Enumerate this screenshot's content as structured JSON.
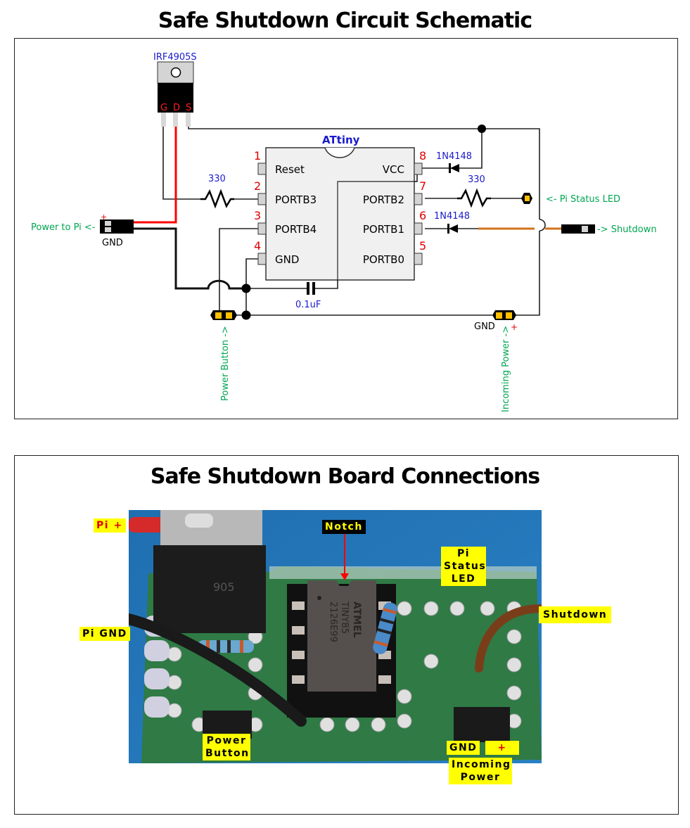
{
  "schematic": {
    "title": "Safe Shutdown Circuit Schematic",
    "mosfet": {
      "part": "IRF4905S",
      "pins": [
        "G",
        "D",
        "S"
      ]
    },
    "chip": {
      "name": "ATtiny",
      "left_pins": [
        {
          "num": "1",
          "label": "Reset"
        },
        {
          "num": "2",
          "label": "PORTB3"
        },
        {
          "num": "3",
          "label": "PORTB4"
        },
        {
          "num": "4",
          "label": "GND"
        }
      ],
      "right_pins": [
        {
          "num": "8",
          "label": "VCC"
        },
        {
          "num": "7",
          "label": "PORTB2"
        },
        {
          "num": "6",
          "label": "PORTB1"
        },
        {
          "num": "5",
          "label": "PORTB0"
        }
      ]
    },
    "components": {
      "resistor_gate": "330",
      "resistor_led": "330",
      "diode_vcc": "1N4148",
      "diode_shutdown": "1N4148",
      "capacitor": "0.1uF"
    },
    "connectors": {
      "power_to_pi": "Power to Pi <-",
      "power_to_pi_plus": "+",
      "power_to_pi_gnd": "GND",
      "pi_status_led": "<- Pi Status LED",
      "shutdown": "-> Shutdown",
      "power_button": "Power Button ->",
      "incoming_power": "Incoming Power ->",
      "incoming_gnd": "GND",
      "incoming_plus": "+"
    },
    "colors": {
      "wire": "#222222",
      "drain_wire": "#ff0000",
      "shutdown_wire": "#d2731c",
      "pin_number": "#e00000",
      "component_label": "#1a1acc",
      "connector_label": "#00a651",
      "header_pad": "#ffc000"
    }
  },
  "board": {
    "title": "Safe Shutdown Board Connections",
    "labels": {
      "pi_plus": "Pi",
      "pi_plus_sign": "+",
      "pi_gnd": "Pi GND",
      "notch": "Notch",
      "pi_status_led": [
        "Pi",
        "Status",
        "LED"
      ],
      "shutdown": "Shutdown",
      "power_button": [
        "Power",
        "Button"
      ],
      "gnd": "GND",
      "plus": "+",
      "incoming_power": [
        "Incoming",
        "Power"
      ]
    },
    "chip_marking": [
      "ATMEL",
      "TINY85",
      "2126E99"
    ],
    "mosfet_marking": "905"
  }
}
